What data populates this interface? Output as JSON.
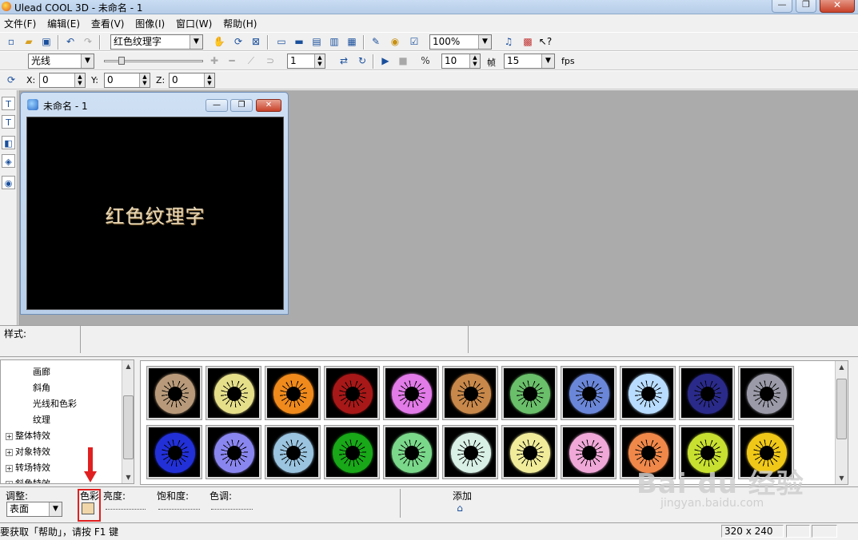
{
  "window": {
    "title": "Ulead COOL 3D - 未命名 - 1",
    "close": "✕",
    "minimize": "—",
    "maximize": "❐"
  },
  "menu": [
    "文件(F)",
    "编辑(E)",
    "查看(V)",
    "图像(I)",
    "窗口(W)",
    "帮助(H)"
  ],
  "toolbar1": {
    "object_select": "红色纹理字",
    "zoom": "100%"
  },
  "toolbar2": {
    "light_select": "光线",
    "frame_value": "1",
    "fps_value": "10",
    "frame_label": "帧",
    "frames_total": "15",
    "fps_label": "fps"
  },
  "toolbar3": {
    "x_label": "X:",
    "x_value": "0",
    "y_label": "Y:",
    "y_value": "0",
    "z_label": "Z:",
    "z_value": "0"
  },
  "doc": {
    "title": "未命名 - 1",
    "text3d": "红色纹理字"
  },
  "style_panel": {
    "label": "样式:"
  },
  "tree": {
    "items": [
      {
        "label": "画廊",
        "indent": 2,
        "expander": ""
      },
      {
        "label": "斜角",
        "indent": 2,
        "expander": ""
      },
      {
        "label": "光线和色彩",
        "indent": 2,
        "expander": ""
      },
      {
        "label": "纹理",
        "indent": 2,
        "expander": ""
      },
      {
        "label": "整体特效",
        "indent": 1,
        "expander": "+"
      },
      {
        "label": "对象特效",
        "indent": 1,
        "expander": "+"
      },
      {
        "label": "转场特效",
        "indent": 1,
        "expander": "+"
      },
      {
        "label": "斜角特效",
        "indent": 1,
        "expander": "+"
      }
    ]
  },
  "gallery": {
    "row1": [
      "#b89a7a",
      "#e6df8a",
      "#f08a1c",
      "#a81818",
      "#e27ae8",
      "#c8884a",
      "#6abf6a",
      "#6a86d8",
      "#b8dcff",
      "#2a2a8a",
      "#9a9aa8"
    ],
    "row2": [
      "#2230d8",
      "#8a86f0",
      "#9ac4e0",
      "#18a818",
      "#7ad88a",
      "#d8f0e6",
      "#f0ec9a",
      "#f0a8d8",
      "#f0884a",
      "#c8e030",
      "#f0c818"
    ]
  },
  "adjust": {
    "label": "调整:",
    "surface_select": "表面",
    "color_label": "色彩",
    "brightness_label": "亮度:",
    "saturation_label": "饱和度:",
    "hue_label": "色调:",
    "add_label": "添加"
  },
  "status": {
    "help_text": "要获取「帮助」，请按 F1 键",
    "resolution": "320 x 240"
  },
  "watermark": {
    "brand": "Bai du 经验",
    "url": "jingyan.baidu.com"
  }
}
